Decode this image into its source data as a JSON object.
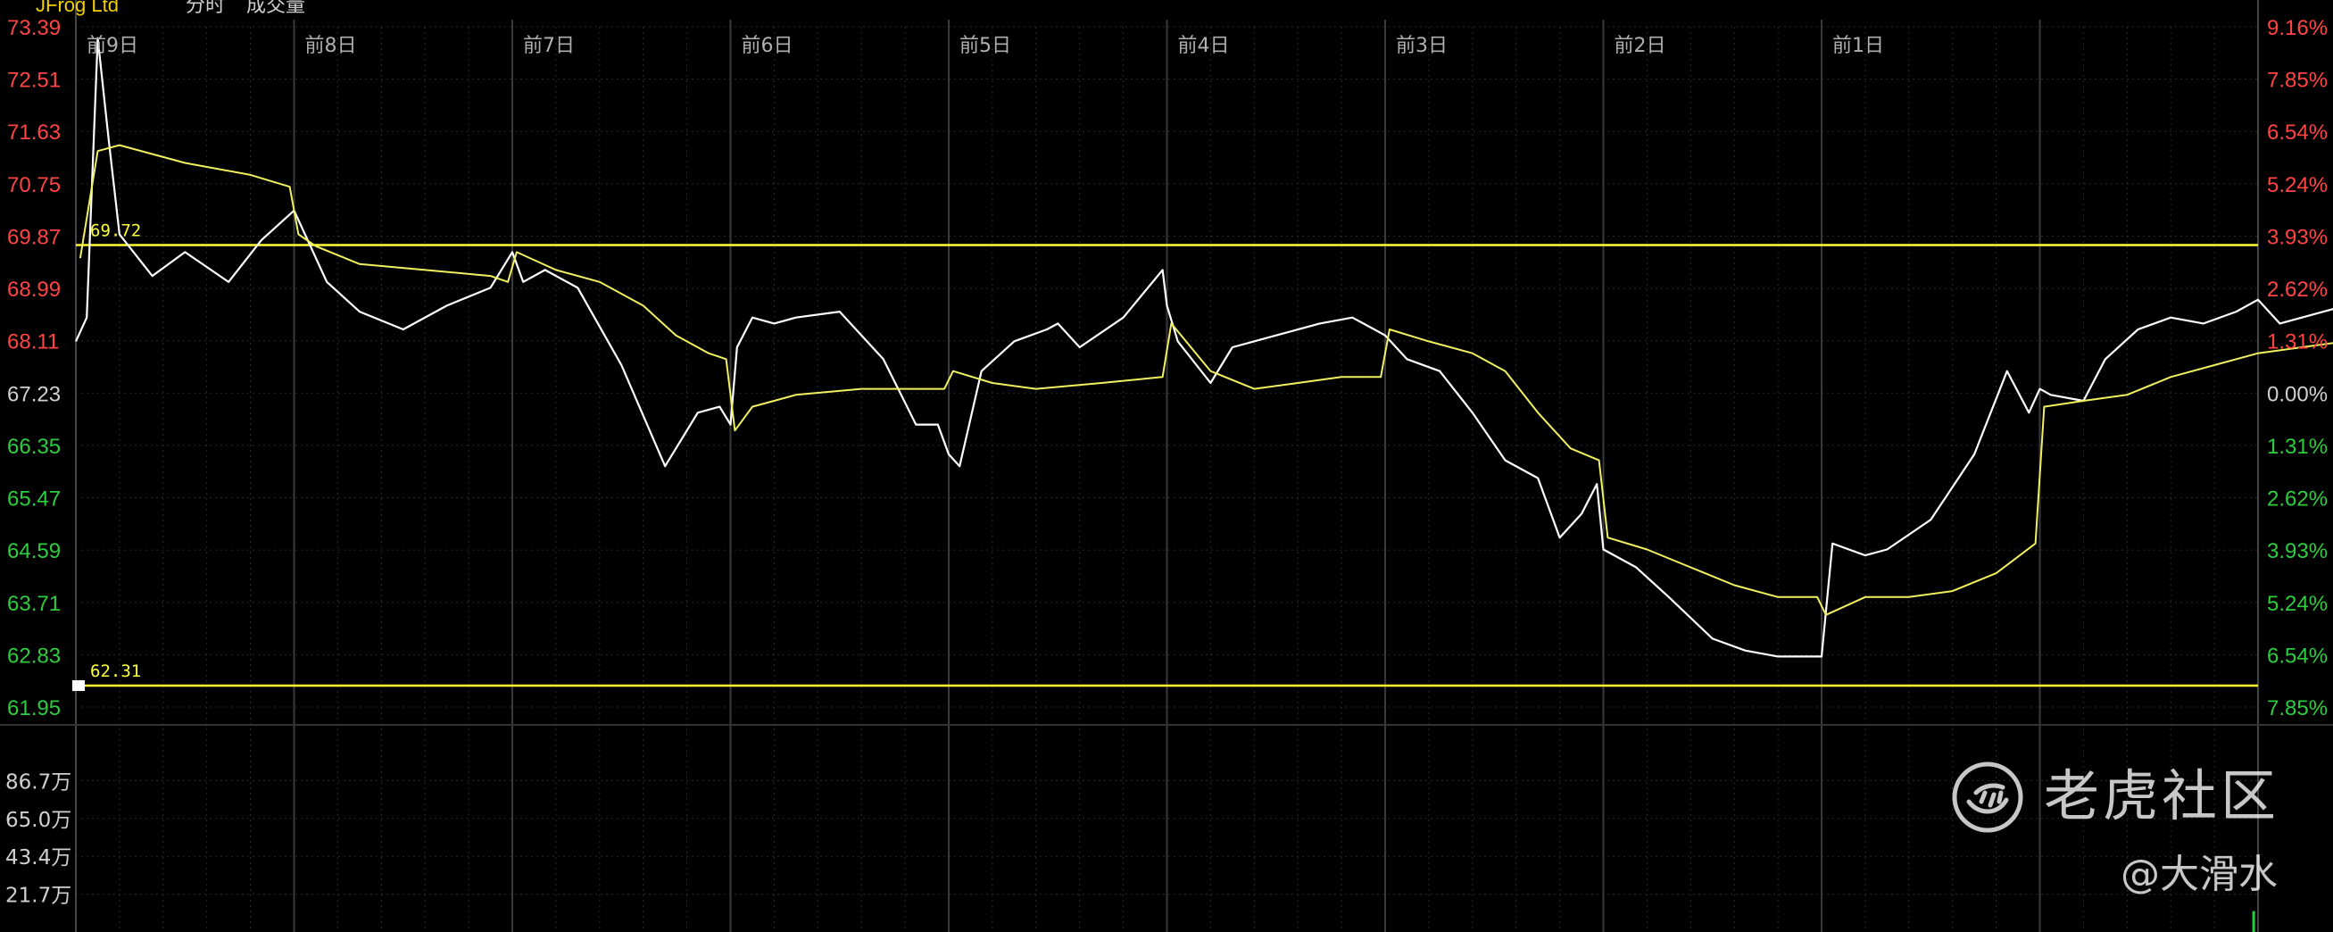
{
  "header": {
    "stock_name": "JFrog Ltd",
    "mode": "分时",
    "volume_label": "成交量"
  },
  "watermark": {
    "brand": "老虎社区",
    "user": "@大滑水"
  },
  "colors": {
    "background": "#000000",
    "grid": "#2a2a2a",
    "price_line": "#ffffff",
    "avg_line": "#f0f060",
    "level_line": "#ffff33",
    "up_text": "#ff4444",
    "down_text": "#2ecc40",
    "neutral_text": "#d0d0d0",
    "day_label": "#b0b0b0"
  },
  "chart_data": {
    "type": "line",
    "title": "",
    "days": [
      "前9日",
      "前8日",
      "前7日",
      "前6日",
      "前5日",
      "前4日",
      "前3日",
      "前2日",
      "前1日",
      "",
      ""
    ],
    "price_axis": {
      "ticks": [
        "73.39",
        "72.51",
        "71.63",
        "70.75",
        "69.87",
        "68.99",
        "68.11",
        "67.23",
        "66.35",
        "65.47",
        "64.59",
        "63.71",
        "62.83",
        "61.95"
      ],
      "reference": 67.23,
      "range": [
        61.95,
        73.39
      ]
    },
    "percent_axis": {
      "ticks": [
        "9.16%",
        "7.85%",
        "6.54%",
        "5.24%",
        "3.93%",
        "2.62%",
        "1.31%",
        "0.00%",
        "1.31%",
        "2.62%",
        "3.93%",
        "5.24%",
        "6.54%",
        "7.85%"
      ]
    },
    "volume_axis": {
      "ticks": [
        "86.7万",
        "65.0万",
        "43.4万",
        "21.7万"
      ],
      "range": [
        0,
        108.4
      ]
    },
    "levels": [
      {
        "label": "69.72",
        "value": 69.72
      },
      {
        "label": "62.31",
        "value": 62.31
      }
    ],
    "series": [
      {
        "role": "price",
        "x": [
          0,
          0.05,
          0.1,
          0.15,
          0.2,
          0.35,
          0.5,
          0.7,
          0.85,
          1.0,
          1.15,
          1.3,
          1.5,
          1.7,
          1.9,
          2.0,
          2.05,
          2.15,
          2.3,
          2.5,
          2.7,
          2.85,
          2.95,
          3.0,
          3.03,
          3.1,
          3.2,
          3.3,
          3.5,
          3.7,
          3.85,
          3.95,
          4.0,
          4.05,
          4.15,
          4.3,
          4.45,
          4.5,
          4.6,
          4.8,
          4.98,
          5.0,
          5.05,
          5.2,
          5.3,
          5.5,
          5.7,
          5.85,
          5.95,
          6.0,
          6.1,
          6.25,
          6.4,
          6.55,
          6.7,
          6.8,
          6.9,
          6.97,
          7.0,
          7.05,
          7.15,
          7.3,
          7.5,
          7.65,
          7.8,
          7.95,
          8.0,
          8.05,
          8.2,
          8.3,
          8.5,
          8.7,
          8.85,
          8.95,
          9.0,
          9.05,
          9.2,
          9.3,
          9.45,
          9.6,
          9.75,
          9.9,
          10.0,
          10.1,
          10.3,
          10.5,
          10.65,
          10.7
        ],
        "values": [
          68.1,
          68.5,
          73.2,
          71.5,
          69.9,
          69.2,
          69.6,
          69.1,
          69.8,
          70.3,
          69.1,
          68.6,
          68.3,
          68.7,
          69.0,
          69.6,
          69.1,
          69.3,
          69.0,
          67.7,
          66.0,
          66.9,
          67.0,
          66.7,
          68.0,
          68.5,
          68.4,
          68.5,
          68.6,
          67.8,
          66.7,
          66.7,
          66.2,
          66.0,
          67.6,
          68.1,
          68.3,
          68.4,
          68.0,
          68.5,
          69.3,
          68.7,
          68.1,
          67.4,
          68.0,
          68.2,
          68.4,
          68.5,
          68.3,
          68.2,
          67.8,
          67.6,
          66.9,
          66.1,
          65.8,
          64.8,
          65.2,
          65.7,
          64.6,
          64.5,
          64.3,
          63.8,
          63.1,
          62.9,
          62.8,
          62.8,
          62.8,
          64.7,
          64.5,
          64.6,
          65.1,
          66.2,
          67.6,
          66.9,
          67.3,
          67.2,
          67.1,
          67.8,
          68.3,
          68.5,
          68.4,
          68.6,
          68.8,
          68.4,
          68.6,
          68.8,
          68.6,
          68.8
        ]
      },
      {
        "role": "average",
        "x": [
          0.02,
          0.1,
          0.2,
          0.5,
          0.8,
          0.98,
          1.02,
          1.1,
          1.3,
          1.6,
          1.9,
          1.98,
          2.02,
          2.2,
          2.4,
          2.6,
          2.75,
          2.9,
          2.98,
          3.02,
          3.1,
          3.3,
          3.6,
          3.98,
          4.02,
          4.2,
          4.4,
          4.7,
          4.98,
          5.02,
          5.2,
          5.4,
          5.6,
          5.8,
          5.98,
          6.02,
          6.2,
          6.4,
          6.55,
          6.7,
          6.85,
          6.98,
          7.02,
          7.2,
          7.4,
          7.6,
          7.8,
          7.98,
          8.02,
          8.2,
          8.4,
          8.6,
          8.8,
          8.98,
          9.02,
          9.2,
          9.4,
          9.6,
          9.8,
          10.0,
          10.2,
          10.4,
          10.6,
          10.7
        ],
        "values": [
          69.5,
          71.3,
          71.4,
          71.1,
          70.9,
          70.7,
          69.9,
          69.7,
          69.4,
          69.3,
          69.2,
          69.1,
          69.6,
          69.3,
          69.1,
          68.7,
          68.2,
          67.9,
          67.8,
          66.6,
          67.0,
          67.2,
          67.3,
          67.3,
          67.6,
          67.4,
          67.3,
          67.4,
          67.5,
          68.4,
          67.6,
          67.3,
          67.4,
          67.5,
          67.5,
          68.3,
          68.1,
          67.9,
          67.6,
          66.9,
          66.3,
          66.1,
          64.8,
          64.6,
          64.3,
          64.0,
          63.8,
          63.8,
          63.5,
          63.8,
          63.8,
          63.9,
          64.2,
          64.7,
          67.0,
          67.1,
          67.2,
          67.5,
          67.7,
          67.9,
          68.0,
          68.1,
          68.3,
          68.4
        ]
      }
    ],
    "volume_bars": [
      {
        "x": 9.98,
        "value": 12.0,
        "color": "#2ecc40"
      },
      {
        "x": 10.62,
        "value": 2.5,
        "color": "#ff4444"
      }
    ]
  }
}
